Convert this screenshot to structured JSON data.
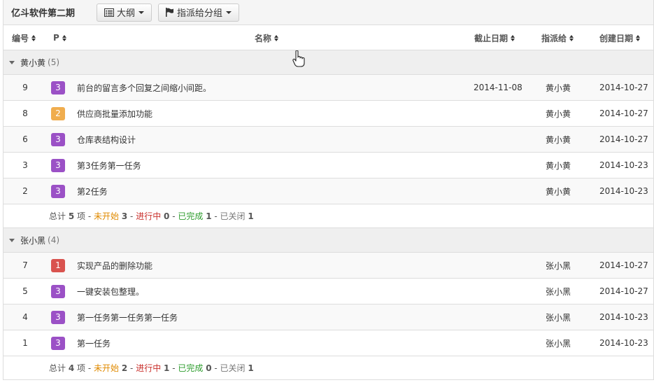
{
  "toolbar": {
    "project_title": "亿斗软件第二期",
    "outline_label": "大纲",
    "assign_group_label": "指派给分组"
  },
  "columns": {
    "id": "编号",
    "pri": "P",
    "name": "名称",
    "deadline": "截止日期",
    "assignee": "指派给",
    "created": "创建日期"
  },
  "colors": {
    "pri_1": "#d9534f",
    "pri_2": "#f0ad4e",
    "pri_3": "#9b51c6"
  },
  "groups": [
    {
      "name": "黄小黄",
      "count": "(5)",
      "rows": [
        {
          "id": "9",
          "pri": "3",
          "name": "前台的留言多个回复之间缩小间距。",
          "deadline": "2014-11-08",
          "assignee": "黄小黄",
          "created": "2014-10-27"
        },
        {
          "id": "8",
          "pri": "2",
          "name": "供应商批量添加功能",
          "deadline": "",
          "assignee": "黄小黄",
          "created": "2014-10-27"
        },
        {
          "id": "6",
          "pri": "3",
          "name": "仓库表结构设计",
          "deadline": "",
          "assignee": "黄小黄",
          "created": "2014-10-27"
        },
        {
          "id": "3",
          "pri": "3",
          "name": "第3任务第一任务",
          "deadline": "",
          "assignee": "黄小黄",
          "created": "2014-10-23"
        },
        {
          "id": "2",
          "pri": "3",
          "name": "第2任务",
          "deadline": "",
          "assignee": "黄小黄",
          "created": "2014-10-23"
        }
      ],
      "summary": {
        "total_prefix": "总计",
        "total": "5",
        "total_suffix": "项",
        "not_started_label": "未开始",
        "not_started": "3",
        "in_progress_label": "进行中",
        "in_progress": "0",
        "done_label": "已完成",
        "done": "1",
        "closed_label": "已关闭",
        "closed": "1"
      }
    },
    {
      "name": "张小黑",
      "count": "(4)",
      "rows": [
        {
          "id": "7",
          "pri": "1",
          "name": "实现产品的删除功能",
          "deadline": "",
          "assignee": "张小黑",
          "created": "2014-10-27"
        },
        {
          "id": "5",
          "pri": "3",
          "name": "一键安装包整理。",
          "deadline": "",
          "assignee": "张小黑",
          "created": "2014-10-27"
        },
        {
          "id": "4",
          "pri": "3",
          "name": "第一任务第一任务第一任务",
          "deadline": "",
          "assignee": "张小黑",
          "created": "2014-10-23"
        },
        {
          "id": "1",
          "pri": "3",
          "name": "第一任务",
          "deadline": "",
          "assignee": "张小黑",
          "created": "2014-10-23"
        }
      ],
      "summary": {
        "total_prefix": "总计",
        "total": "4",
        "total_suffix": "项",
        "not_started_label": "未开始",
        "not_started": "2",
        "in_progress_label": "进行中",
        "in_progress": "1",
        "done_label": "已完成",
        "done": "0",
        "closed_label": "已关闭",
        "closed": "1"
      }
    }
  ]
}
